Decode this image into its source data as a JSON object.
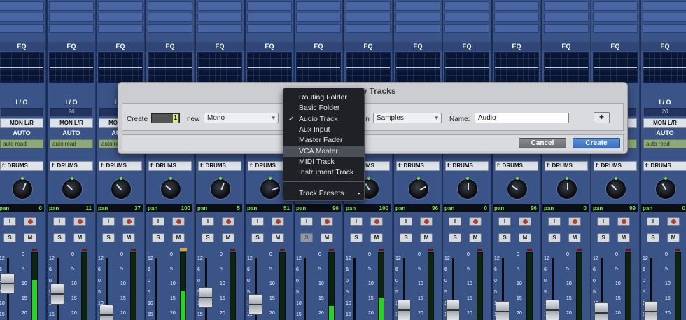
{
  "eq_label": "EQ",
  "io_label": "I / O",
  "mon_label": "MON L/R",
  "auto_label": "AUTO",
  "auto_mode": "auto read",
  "insert_label": "f: DRUMS",
  "pan_label": "pan",
  "input_button": "I",
  "solo_button": "S",
  "mute_button": "M",
  "meter_scale": [
    "0",
    "5",
    "10",
    "15",
    "20"
  ],
  "fader_scale": [
    "12",
    "6",
    "0",
    "5",
    "10",
    "15",
    "20"
  ],
  "strips": [
    {
      "io_num": "",
      "pan": "0",
      "pan_dir": "◂ ▸"
    },
    {
      "io_num": "26",
      "pan": "11",
      "pan_dir": "◂"
    },
    {
      "io_num": "27",
      "pan": "37",
      "pan_dir": "◂"
    },
    {
      "io_num": "",
      "pan": "100",
      "pan_dir": ""
    },
    {
      "io_num": "",
      "pan": "5",
      "pan_dir": "◂"
    },
    {
      "io_num": "",
      "pan": "51",
      "pan_dir": ""
    },
    {
      "io_num": "",
      "pan": "96",
      "pan_dir": "◂"
    },
    {
      "io_num": "",
      "pan": "100",
      "pan_dir": ""
    },
    {
      "io_num": "",
      "pan": "96",
      "pan_dir": "◂"
    },
    {
      "io_num": "",
      "pan": "0",
      "pan_dir": "◂ ▸"
    },
    {
      "io_num": "",
      "pan": "96",
      "pan_dir": ""
    },
    {
      "io_num": "",
      "pan": "0",
      "pan_dir": "◂ ▸"
    },
    {
      "io_num": "",
      "pan": "99",
      "pan_dir": "◂"
    },
    {
      "io_num": "20",
      "pan": "0",
      "pan_dir": "◂ ▸"
    }
  ],
  "dialog": {
    "title": "New Tracks",
    "create_label": "Create",
    "count_value": "1",
    "new_label": "new",
    "format_value": "Mono",
    "in_label": "in",
    "timebase_value": "Samples",
    "name_label": "Name:",
    "name_value": "Audio",
    "add_button": "+",
    "cancel_button": "Cancel",
    "create_button": "Create"
  },
  "menu": {
    "items": [
      "Routing Folder",
      "Basic Folder",
      "Audio Track",
      "Aux Input",
      "Master Fader",
      "VCA Master",
      "MIDI Track",
      "Instrument Track"
    ],
    "checked_index": 2,
    "highlighted_index": 5,
    "check_mark": "✓",
    "submenu_item": "Track Presets",
    "submenu_arrow": "▸"
  }
}
